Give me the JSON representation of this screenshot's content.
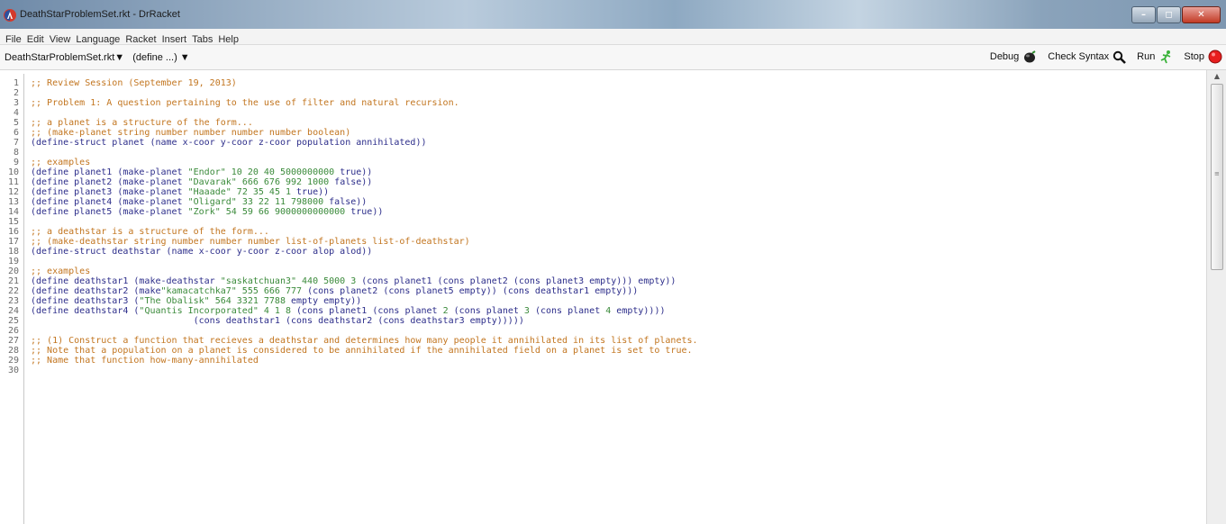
{
  "window": {
    "title": "DeathStarProblemSet.rkt - DrRacket",
    "buttons": {
      "minimize": "–",
      "maximize": "◻",
      "close": "✕"
    }
  },
  "menu": [
    "File",
    "Edit",
    "View",
    "Language",
    "Racket",
    "Insert",
    "Tabs",
    "Help"
  ],
  "toolbar": {
    "file_selector": "DeathStarProblemSet.rkt▼",
    "define_selector": "(define ...) ▼",
    "debug_label": "Debug",
    "check_syntax_label": "Check Syntax",
    "run_label": "Run",
    "stop_label": "Stop"
  },
  "colors": {
    "comment": "#c2751f",
    "code": "#2c2d8a",
    "string": "#3a8a3a",
    "stop": "#e81e1e"
  },
  "editor": {
    "lines": [
      {
        "n": "1",
        "segs": [
          {
            "t": ";; Review Session (September 19, 2013)",
            "c": "comment"
          }
        ]
      },
      {
        "n": "2",
        "segs": []
      },
      {
        "n": "3",
        "segs": [
          {
            "t": ";; Problem 1: A question pertaining to the use of filter and natural recursion.",
            "c": "comment"
          }
        ]
      },
      {
        "n": "4",
        "segs": []
      },
      {
        "n": "5",
        "segs": [
          {
            "t": ";; a planet is a structure of the form...",
            "c": "comment"
          }
        ]
      },
      {
        "n": "6",
        "segs": [
          {
            "t": ";; (make-planet string number number number number boolean)",
            "c": "comment"
          }
        ]
      },
      {
        "n": "7",
        "segs": [
          {
            "t": "(define-struct planet (name x-coor y-coor z-coor population annihilated))",
            "c": "code"
          }
        ]
      },
      {
        "n": "8",
        "segs": []
      },
      {
        "n": "9",
        "segs": [
          {
            "t": ";; examples",
            "c": "comment"
          }
        ]
      },
      {
        "n": "10",
        "segs": [
          {
            "t": "(define planet1 (make-planet ",
            "c": "code"
          },
          {
            "t": "\"Endor\" 10 20 40 5000000000 ",
            "c": "string"
          },
          {
            "t": "true))",
            "c": "code"
          }
        ]
      },
      {
        "n": "11",
        "segs": [
          {
            "t": "(define planet2 (make-planet ",
            "c": "code"
          },
          {
            "t": "\"Davarak\" 666 676 992 1000 ",
            "c": "string"
          },
          {
            "t": "false))",
            "c": "code"
          }
        ]
      },
      {
        "n": "12",
        "segs": [
          {
            "t": "(define planet3 (make-planet ",
            "c": "code"
          },
          {
            "t": "\"Haaade\" 72 35 45 1 ",
            "c": "string"
          },
          {
            "t": "true))",
            "c": "code"
          }
        ]
      },
      {
        "n": "13",
        "segs": [
          {
            "t": "(define planet4 (make-planet ",
            "c": "code"
          },
          {
            "t": "\"Oligard\" 33 22 11 798000 ",
            "c": "string"
          },
          {
            "t": "false))",
            "c": "code"
          }
        ]
      },
      {
        "n": "14",
        "segs": [
          {
            "t": "(define planet5 (make-planet ",
            "c": "code"
          },
          {
            "t": "\"Zork\" 54 59 66 9000000000000 ",
            "c": "string"
          },
          {
            "t": "true))",
            "c": "code"
          }
        ]
      },
      {
        "n": "15",
        "segs": []
      },
      {
        "n": "16",
        "segs": [
          {
            "t": ";; a deathstar is a structure of the form...",
            "c": "comment"
          }
        ]
      },
      {
        "n": "17",
        "segs": [
          {
            "t": ";; (make-deathstar string number number number list-of-planets list-of-deathstar)",
            "c": "comment"
          }
        ]
      },
      {
        "n": "18",
        "segs": [
          {
            "t": "(define-struct deathstar (name x-coor y-coor z-coor alop alod))",
            "c": "code"
          }
        ]
      },
      {
        "n": "19",
        "segs": []
      },
      {
        "n": "20",
        "segs": [
          {
            "t": ";; examples",
            "c": "comment"
          }
        ]
      },
      {
        "n": "21",
        "segs": [
          {
            "t": "(define deathstar1 (make-deathstar ",
            "c": "code"
          },
          {
            "t": "\"saskatchuan3\" 440 5000 3 ",
            "c": "string"
          },
          {
            "t": "(cons planet1 (cons planet2 (cons planet3 empty))) empty))",
            "c": "code"
          }
        ]
      },
      {
        "n": "22",
        "segs": [
          {
            "t": "(define deathstar2 (make",
            "c": "code"
          },
          {
            "t": "\"kamacatchka7\" 555 666 777 ",
            "c": "string"
          },
          {
            "t": "(cons planet2 (cons planet5 empty)) (cons deathstar1 empty)))",
            "c": "code"
          }
        ]
      },
      {
        "n": "23",
        "segs": [
          {
            "t": "(define deathstar3 (",
            "c": "code"
          },
          {
            "t": "\"The Obalisk\" 564 3321 7788 ",
            "c": "string"
          },
          {
            "t": "empty empty))",
            "c": "code"
          }
        ]
      },
      {
        "n": "24",
        "segs": [
          {
            "t": "(define deathstar4 (",
            "c": "code"
          },
          {
            "t": "\"Quantis Incorporated\" 4 1 8 ",
            "c": "string"
          },
          {
            "t": "(cons planet1 (cons planet ",
            "c": "code"
          },
          {
            "t": "2 ",
            "c": "string"
          },
          {
            "t": "(cons planet ",
            "c": "code"
          },
          {
            "t": "3 ",
            "c": "string"
          },
          {
            "t": "(cons planet ",
            "c": "code"
          },
          {
            "t": "4 ",
            "c": "string"
          },
          {
            "t": "empty))))",
            "c": "code"
          }
        ]
      },
      {
        "n": "25",
        "segs": [
          {
            "t": "                              (cons deathstar1 (cons deathstar2 (cons deathstar3 empty)))))",
            "c": "code"
          }
        ]
      },
      {
        "n": "26",
        "segs": []
      },
      {
        "n": "27",
        "segs": [
          {
            "t": ";; (1) Construct a function that recieves a deathstar and determines how many people it annihilated in its list of planets.",
            "c": "comment"
          }
        ]
      },
      {
        "n": "28",
        "segs": [
          {
            "t": ";; Note that a population on a planet is considered to be annihilated if the annihilated field on a planet is set to true.",
            "c": "comment"
          }
        ]
      },
      {
        "n": "29",
        "segs": [
          {
            "t": ";; Name that function how-many-annihilated",
            "c": "comment"
          }
        ]
      },
      {
        "n": "30",
        "segs": []
      }
    ]
  }
}
